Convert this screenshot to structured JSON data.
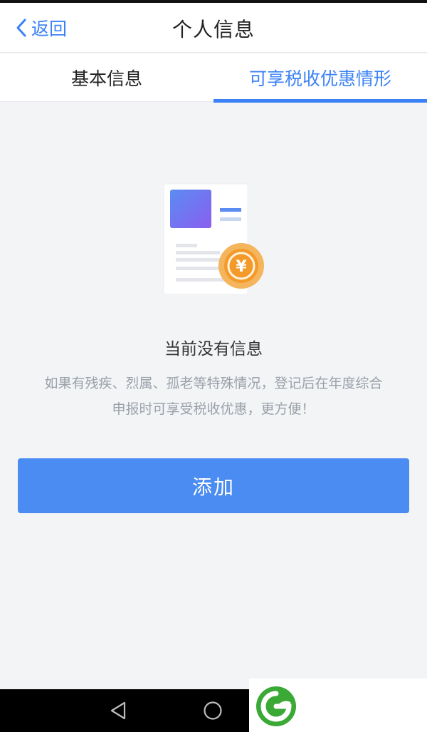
{
  "header": {
    "back_label": "返回",
    "title": "个人信息"
  },
  "tabs": [
    {
      "label": "基本信息",
      "active": false
    },
    {
      "label": "可享税收优惠情形",
      "active": true
    }
  ],
  "empty_state": {
    "title": "当前没有信息",
    "description_line1": "如果有残疾、烈属、孤老等特殊情况，登记后在年度综合",
    "description_line2": "申报时可享受税收优惠，更方便！",
    "illustration_icon": "document-yuan-icon",
    "coin_symbol": "¥"
  },
  "add_button": {
    "label": "添加"
  },
  "system_nav": {
    "back_icon": "triangle-back-icon",
    "home_icon": "circle-home-icon"
  },
  "colors": {
    "accent": "#3b82f6",
    "button": "#4a8cf2",
    "coin": "#f2a33a",
    "doc_square": "#6f6ff0"
  }
}
